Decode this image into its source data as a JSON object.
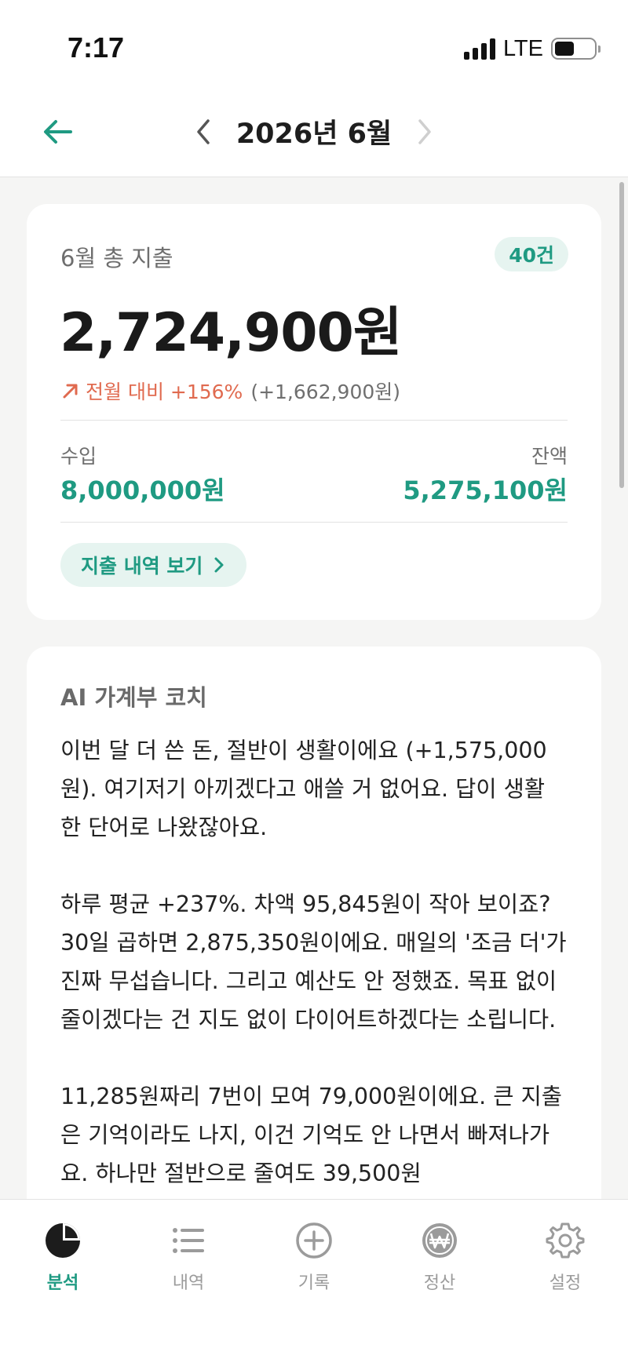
{
  "status_bar": {
    "time": "7:17",
    "network": "LTE"
  },
  "header": {
    "title": "2026년 6월"
  },
  "summary": {
    "label": "6월 총 지출",
    "count_badge": "40건",
    "total": "2,724,900원",
    "compare_text": "전월 대비 +156%",
    "compare_diff": "(+1,662,900원)",
    "income_label": "수입",
    "income_value": "8,000,000원",
    "balance_label": "잔액",
    "balance_value": "5,275,100원",
    "history_button": "지출 내역 보기"
  },
  "coach": {
    "title": "AI 가계부 코치",
    "paragraphs": [
      "이번 달 더 쓴 돈, 절반이 생활이에요 (+1,575,000원). 여기저기 아끼겠다고 애쓸 거 없어요. 답이 생활 한 단어로 나왔잖아요.",
      "하루 평균 +237%. 차액 95,845원이 작아 보이죠? 30일 곱하면 2,875,350원이에요. 매일의 '조금 더'가 진짜 무섭습니다. 그리고 예산도 안 정했죠. 목표 없이 줄이겠다는 건 지도 없이 다이어트하겠다는 소립니다.",
      "11,285원짜리 7번이 모여 79,000원이에요. 큰 지출은 기억이라도 나지, 이건 기억도 안 나면서 빠져나가요. 하나만 절반으로 줄여도 39,500원"
    ]
  },
  "tabs": [
    {
      "label": "분석",
      "icon": "pie-chart-icon",
      "active": true
    },
    {
      "label": "내역",
      "icon": "list-icon",
      "active": false
    },
    {
      "label": "기록",
      "icon": "plus-circle-icon",
      "active": false
    },
    {
      "label": "정산",
      "icon": "won-coin-icon",
      "active": false
    },
    {
      "label": "설정",
      "icon": "gear-icon",
      "active": false
    }
  ],
  "colors": {
    "accent": "#1f9a82",
    "accent_bg": "#e6f4f0",
    "increase": "#e06a4f",
    "background": "#f5f5f4"
  }
}
